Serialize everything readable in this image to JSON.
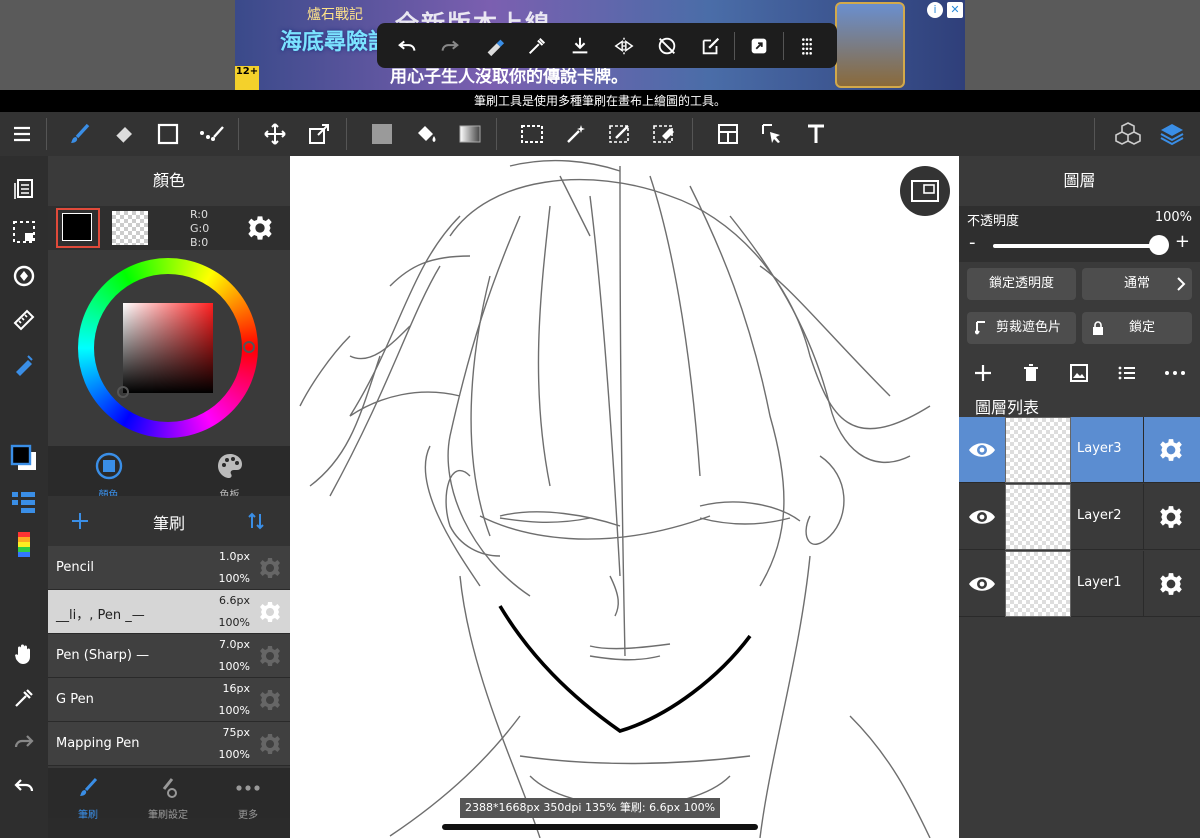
{
  "ad": {
    "logo_line1": "爐石戰記",
    "logo_line2": "海底尋險記",
    "age": "12+",
    "headline": "全新版本上線",
    "sub": "用心子生人沒取你的傳說卡牌。"
  },
  "hint_text": "筆刷工具是使用多種筆刷在畫布上繪圖的工具。",
  "color_panel": {
    "title": "顏色",
    "r": "R:0",
    "g": "G:0",
    "b": "B:0",
    "tab_color": "顏色",
    "tab_palette": "色板"
  },
  "brush_panel": {
    "title": "筆刷",
    "items": [
      {
        "name": "Pencil",
        "size": "1.0px",
        "opacity": "100%"
      },
      {
        "name": "__li，, Pen _—",
        "size": "6.6px",
        "opacity": "100%"
      },
      {
        "name": "Pen (Sharp) —",
        "size": "7.0px",
        "opacity": "100%"
      },
      {
        "name": "G Pen",
        "size": "16px",
        "opacity": "100%"
      },
      {
        "name": "Mapping Pen",
        "size": "75px",
        "opacity": "100%"
      }
    ],
    "tab_brush": "筆刷",
    "tab_settings": "筆刷設定",
    "tab_more": "更多"
  },
  "canvas": {
    "status": "2388*1668px 350dpi 135% 筆刷: 6.6px 100%"
  },
  "layer_panel": {
    "title": "圖層",
    "opacity_label": "不透明度",
    "opacity_value": "100%",
    "opacity_level": 1.0,
    "lock_alpha": "鎖定透明度",
    "blend_mode": "通常",
    "clipping": "剪裁遮色片",
    "lock": "鎖定",
    "list_title": "圖層列表",
    "layers": [
      {
        "name": "Layer3",
        "active": true
      },
      {
        "name": "Layer2",
        "active": false
      },
      {
        "name": "Layer1",
        "active": false
      }
    ]
  },
  "colors": {
    "accent": "#5b8dd1",
    "panel": "#3a3a3a",
    "toolbar": "#333333",
    "brush_blue": "#3a8ee6"
  }
}
